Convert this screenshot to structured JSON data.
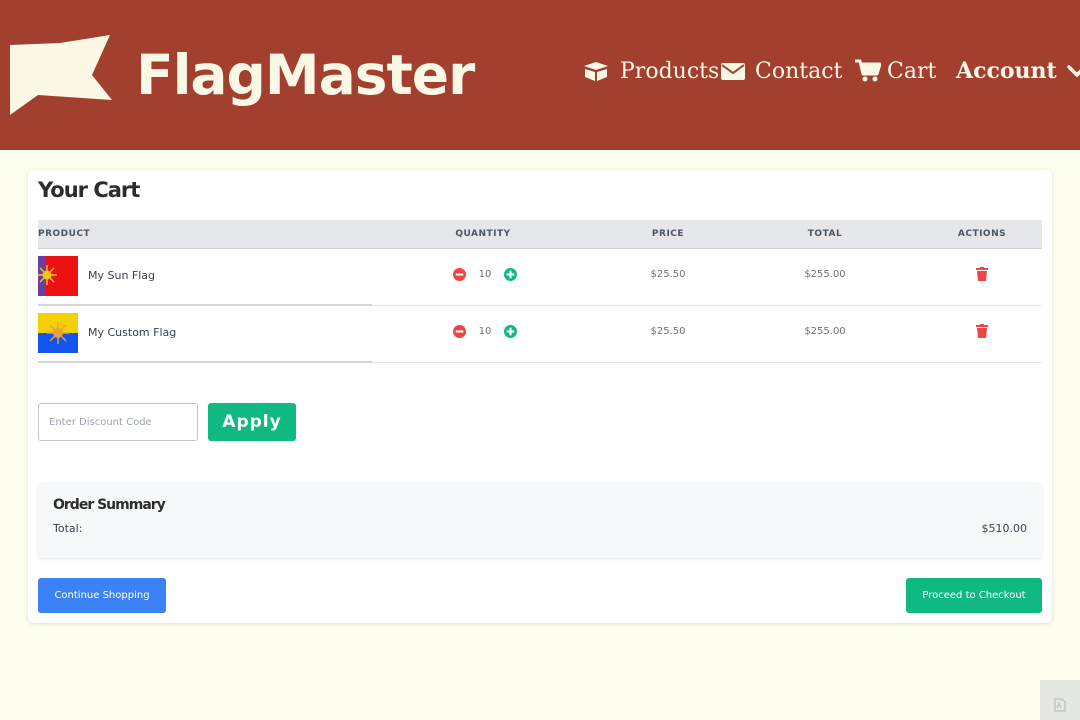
{
  "header": {
    "brand": "FlagMaster",
    "logo_icon": "flag-logo-icon",
    "nav": {
      "products": "Products",
      "contact": "Contact",
      "cart": "Cart",
      "account": "Account"
    },
    "colors": {
      "background": "#a23f2f",
      "text": "#fcf8e6"
    }
  },
  "cart": {
    "title": "Your Cart",
    "columns": {
      "product": "PRODUCT",
      "quantity": "QUANTITY",
      "price": "PRICE",
      "total": "TOTAL",
      "actions": "ACTIONS"
    },
    "items": [
      {
        "name": "My Sun Flag",
        "quantity": "10",
        "price": "$25.50",
        "total": "$255.00",
        "flag_icon": "sun-flag-thumbnail"
      },
      {
        "name": "My Custom Flag",
        "quantity": "10",
        "price": "$25.50",
        "total": "$255.00",
        "flag_icon": "custom-flag-thumbnail"
      }
    ]
  },
  "discount": {
    "placeholder": "Enter Discount Code",
    "apply_label": "Apply"
  },
  "summary": {
    "title": "Order Summary",
    "total_label": "Total:",
    "total_value": "$510.00"
  },
  "actions": {
    "continue_label": "Continue Shopping",
    "checkout_label": "Proceed to Checkout"
  },
  "colors": {
    "page_background": "#fefeee",
    "accent_green": "#10b981",
    "accent_blue": "#3b82f6",
    "danger_red": "#ef4444"
  }
}
